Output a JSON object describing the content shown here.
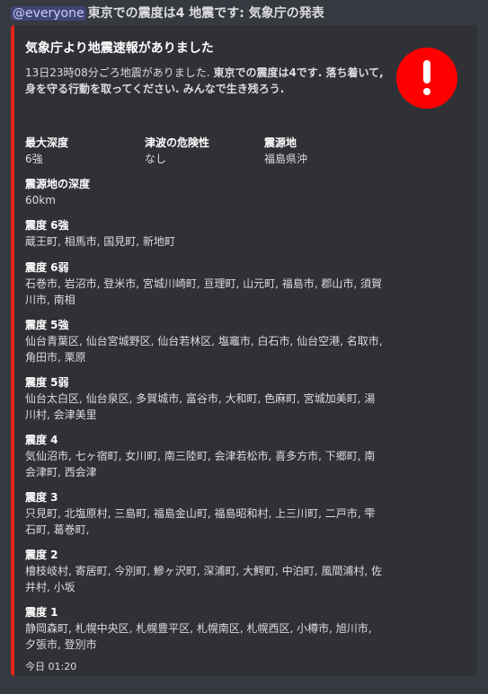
{
  "message": {
    "mention": "@everyone",
    "text": "東京での震度は4 地震です: 気象庁の発表"
  },
  "embed": {
    "accent_color": "#e3251b",
    "title": "気象庁より地震速報がありました",
    "description_lead": "13日23時08分ごろ地震がありました.",
    "description_bold": "東京での震度は4です. 落ち着いて, 身を守る行動を取ってください. みんなで生き残ろう.",
    "icon": "exclamation-alert-icon",
    "icon_color": "#ff0000",
    "inline_fields": [
      {
        "name": "最大深度",
        "value": "6強"
      },
      {
        "name": "津波の危険性",
        "value": "なし"
      },
      {
        "name": "震源地",
        "value": "福島県沖"
      }
    ],
    "fields": [
      {
        "name": "震源地の深度",
        "value": "60km"
      },
      {
        "name": "震度 6強",
        "value": "蔵王町, 相馬市, 国見町, 新地町"
      },
      {
        "name": "震度 6弱",
        "value": "石巻市, 岩沼市, 登米市, 宮城川崎町, 亘理町, 山元町, 福島市, 郡山市, 須賀川市, 南相"
      },
      {
        "name": "震度 5強",
        "value": "仙台青葉区, 仙台宮城野区, 仙台若林区, 塩竈市, 白石市, 仙台空港, 名取市, 角田市, 栗原"
      },
      {
        "name": "震度 5弱",
        "value": "仙台太白区, 仙台泉区, 多賀城市, 富谷市, 大和町, 色麻町, 宮城加美町, 湯川村, 会津美里"
      },
      {
        "name": "震度 4",
        "value": "気仙沼市, 七ヶ宿町, 女川町, 南三陸町, 会津若松市, 喜多方市, 下郷町, 南会津町, 西会津"
      },
      {
        "name": "震度 3",
        "value": "只見町, 北塩原村, 三島町, 福島金山町, 福島昭和村, 上三川町, 二戸市, 雫石町, 葛巻町,"
      },
      {
        "name": "震度 2",
        "value": "檜枝岐村, 寄居町, 今別町, 鰺ヶ沢町, 深浦町, 大鰐町, 中泊町, 風間浦村, 佐井村, 小坂"
      },
      {
        "name": "震度 1",
        "value": "静岡森町, 札幌中央区, 札幌豊平区, 札幌南区, 札幌西区, 小樽市, 旭川市, 夕張市, 登別市"
      }
    ],
    "footer": "今日 01:20"
  }
}
